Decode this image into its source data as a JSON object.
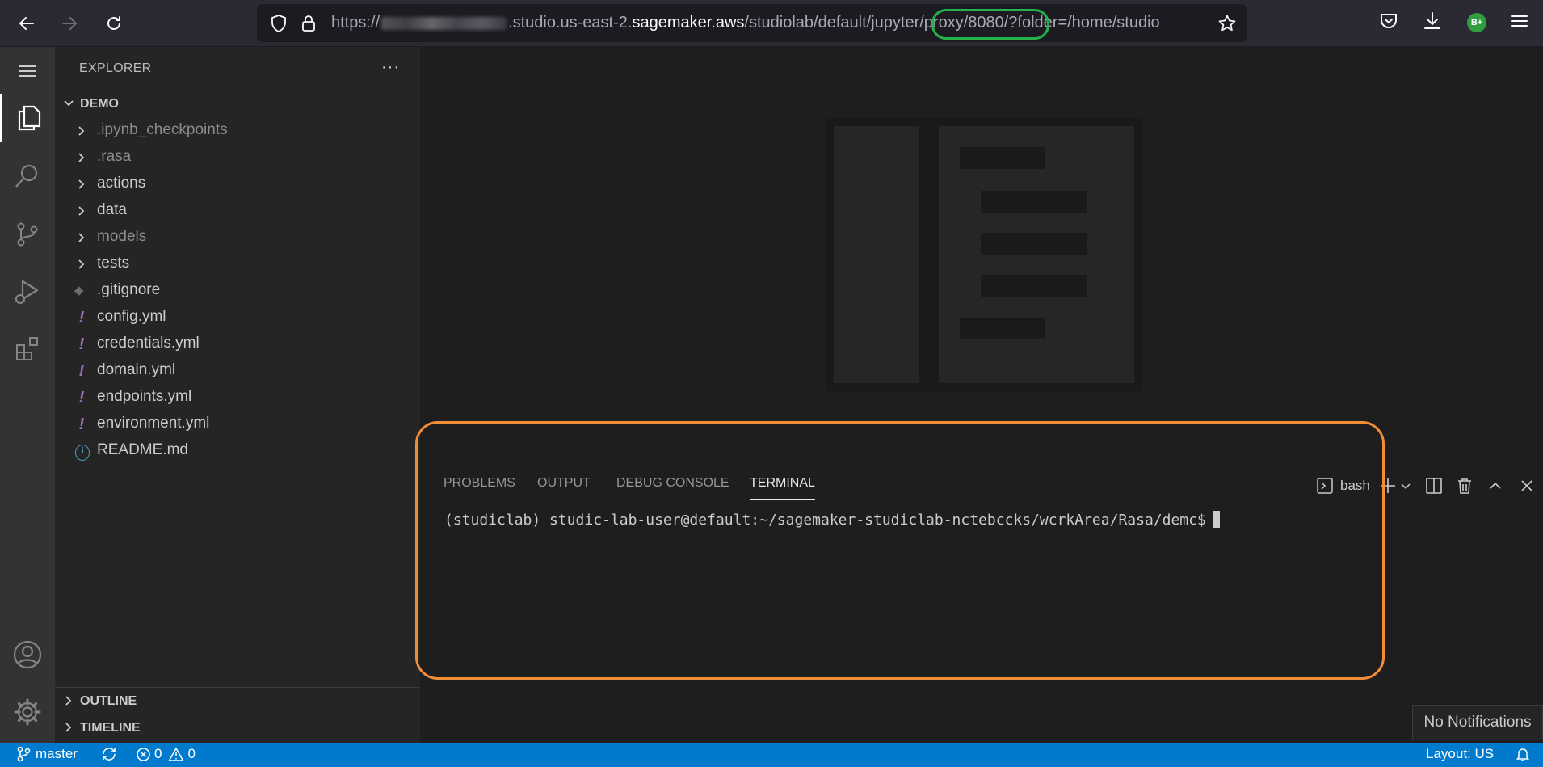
{
  "browser": {
    "url_prefix": "https://",
    "url_domain_pre": ".studio.us-east-2.",
    "url_domain_main": "sagemaker.aws",
    "url_path": "/studiolab/default/jupyter/proxy/8080/?folder=/home/studio",
    "profile_badge": "B+"
  },
  "explorer": {
    "title": "EXPLORER",
    "more": "···",
    "root": "DEMO",
    "items": [
      {
        "label": ".ipynb_checkpoints",
        "kind": "folder",
        "dim": true
      },
      {
        "label": ".rasa",
        "kind": "folder",
        "dim": true
      },
      {
        "label": "actions",
        "kind": "folder",
        "dim": false
      },
      {
        "label": "data",
        "kind": "folder",
        "dim": false
      },
      {
        "label": "models",
        "kind": "folder",
        "dim": true
      },
      {
        "label": "tests",
        "kind": "folder",
        "dim": false
      },
      {
        "label": ".gitignore",
        "kind": "git",
        "dim": false
      },
      {
        "label": "config.yml",
        "kind": "yml",
        "dim": false
      },
      {
        "label": "credentials.yml",
        "kind": "yml",
        "dim": false
      },
      {
        "label": "domain.yml",
        "kind": "yml",
        "dim": false
      },
      {
        "label": "endpoints.yml",
        "kind": "yml",
        "dim": false
      },
      {
        "label": "environment.yml",
        "kind": "yml",
        "dim": false
      },
      {
        "label": "README.md",
        "kind": "info",
        "dim": false
      }
    ],
    "outline": "OUTLINE",
    "timeline": "TIMELINE"
  },
  "panel": {
    "tabs": [
      "PROBLEMS",
      "OUTPUT",
      "DEBUG CONSOLE",
      "TERMINAL"
    ],
    "active_tab": "TERMINAL",
    "shell": "bash",
    "terminal_prompt": "(studiclab) studic-lab-user@default:~/sagemaker-studiclab-nctebccks/wcrkArea/Rasa/demc$"
  },
  "status": {
    "branch": "master",
    "errors": "0",
    "warnings": "0",
    "layout": "Layout: US",
    "notifications": "No Notifications"
  },
  "colors": {
    "accent": "#007acc",
    "highlight_orange": "#f28d35",
    "highlight_green": "#23b34a",
    "yml_icon": "#a074c4"
  }
}
